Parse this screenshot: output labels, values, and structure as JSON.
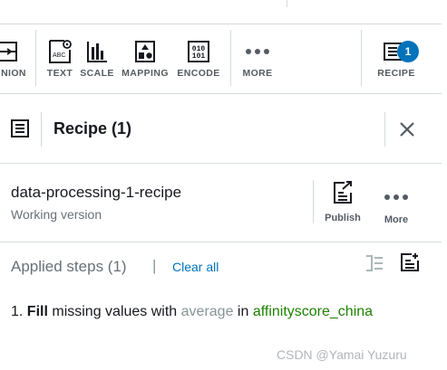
{
  "toolbar": {
    "items": [
      {
        "label": "NION",
        "icon": "union-icon"
      },
      {
        "label": "TEXT",
        "icon": "text-icon"
      },
      {
        "label": "SCALE",
        "icon": "scale-icon"
      },
      {
        "label": "MAPPING",
        "icon": "mapping-icon"
      },
      {
        "label": "ENCODE",
        "icon": "encode-icon"
      },
      {
        "label": "MORE",
        "icon": "more-icon"
      },
      {
        "label": "RECIPE",
        "icon": "recipe-icon"
      }
    ],
    "recipe_badge": "1"
  },
  "panel": {
    "title": "Recipe (1)",
    "icon": "recipe-icon",
    "close_icon": "close-icon"
  },
  "recipe": {
    "name": "data-processing-1-recipe",
    "version": "Working version",
    "publish_label": "Publish",
    "more_label": "More"
  },
  "applied_steps": {
    "title": "Applied steps (1)",
    "separator": "|",
    "clear_all": "Clear all",
    "steps": [
      {
        "index": "1.",
        "action": "Fill",
        "text1": "missing values with",
        "method": "average",
        "text2": "in",
        "column": "affinityscore_china"
      }
    ]
  },
  "watermark": "CSDN @Yamai Yuzuru",
  "colors": {
    "accent": "#0073bb",
    "column": "#1d8102",
    "muted": "#687078",
    "border": "#d5dbdb"
  }
}
